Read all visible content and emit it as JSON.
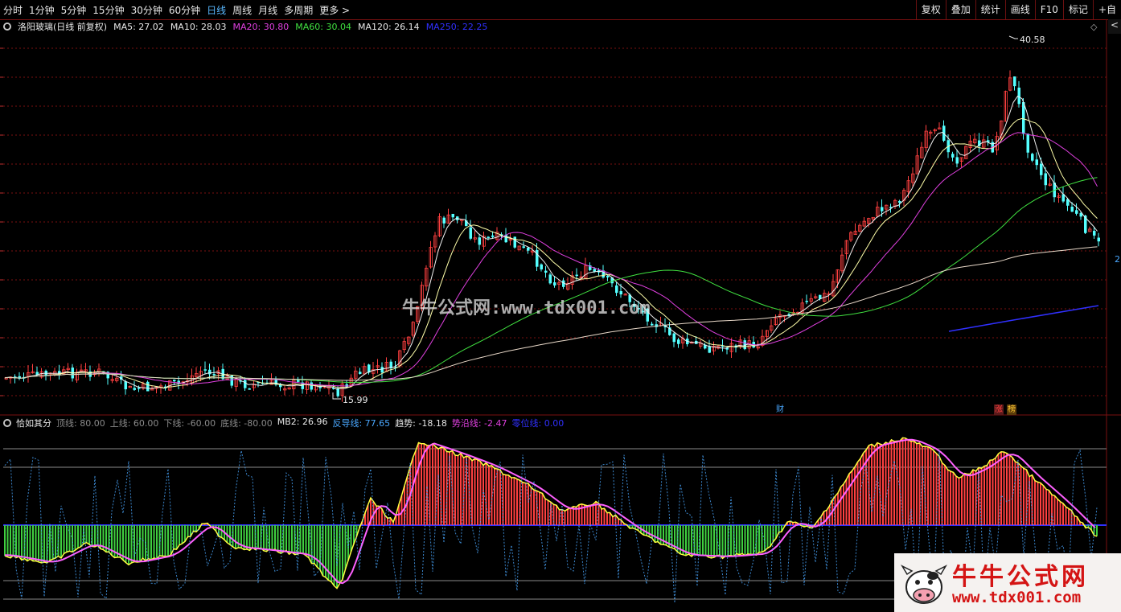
{
  "toolbar": {
    "periods": [
      "分时",
      "1分钟",
      "5分钟",
      "15分钟",
      "30分钟",
      "60分钟",
      "日线",
      "周线",
      "月线",
      "多周期",
      "更多 >"
    ],
    "active_period": "日线",
    "right_buttons": [
      "复权",
      "叠加",
      "统计",
      "画线",
      "F10",
      "标记",
      "+自"
    ]
  },
  "main_legend": {
    "title": "洛阳玻璃(日线 前复权)",
    "ma": [
      {
        "label": "MA5: 27.02",
        "color": "#e8e8e8"
      },
      {
        "label": "MA10: 28.03",
        "color": "#e8e8e8"
      },
      {
        "label": "MA20: 30.80",
        "color": "#e040e0"
      },
      {
        "label": "MA60: 30.04",
        "color": "#40e040"
      },
      {
        "label": "MA120: 26.14",
        "color": "#e8e8e8"
      },
      {
        "label": "MA250: 22.25",
        "color": "#3030ff"
      }
    ]
  },
  "annotations": {
    "high_price": "40.58",
    "low_price": "15.99",
    "axis_mark": "2",
    "badge_cai": "财",
    "badge_zhang": "涨",
    "badge_bang": "榜"
  },
  "sub_legend": {
    "title": "恰如其分",
    "items": [
      {
        "label": "顶线: 80.00",
        "color": "#8a8a8a"
      },
      {
        "label": "上线: 60.00",
        "color": "#8a8a8a"
      },
      {
        "label": "下线: -60.00",
        "color": "#8a8a8a"
      },
      {
        "label": "底线: -80.00",
        "color": "#8a8a8a"
      },
      {
        "label": "MB2: 26.96",
        "color": "#e8e8e8"
      },
      {
        "label": "反导线: 77.65",
        "color": "#4aa8ff"
      },
      {
        "label": "趋势: -18.18",
        "color": "#e8e8e8"
      },
      {
        "label": "势沿线: -2.47",
        "color": "#e040e0"
      },
      {
        "label": "零位线: 0.00",
        "color": "#3030ff"
      }
    ]
  },
  "watermark": "牛牛公式网:www.tdx001.com",
  "logo": {
    "title": "牛牛公式网",
    "url": "www.tdx001.com"
  },
  "colors": {
    "up": "#ff4040",
    "down": "#54ffff",
    "grid": "#7a1010",
    "ma250": "#3030ff",
    "ma60": "#40e040",
    "ma20": "#e040e0"
  }
}
